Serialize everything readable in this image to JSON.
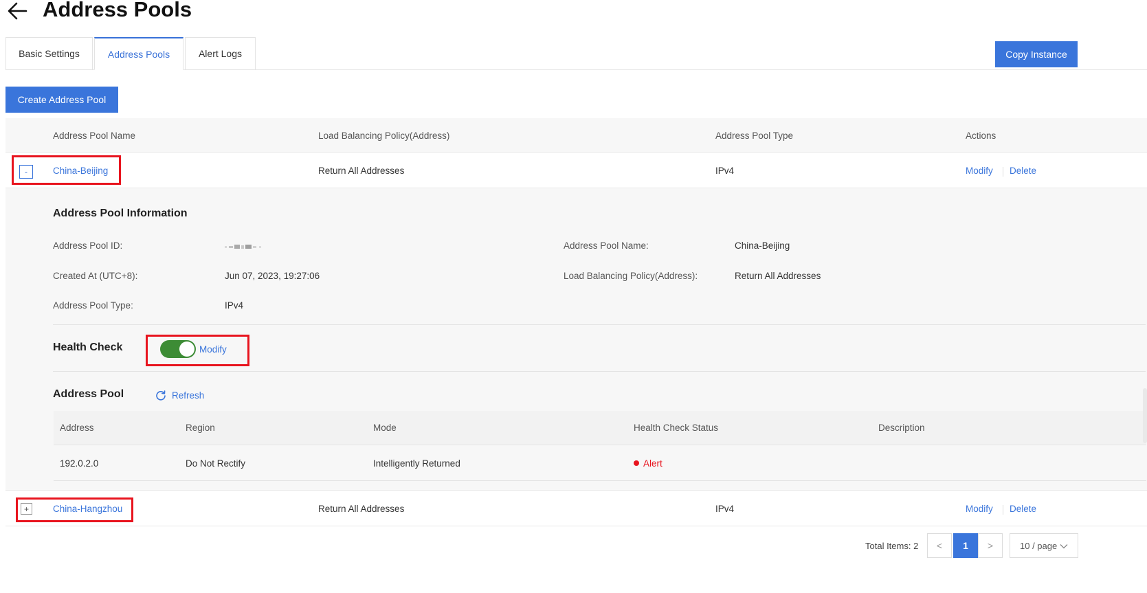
{
  "header": {
    "title": "Address Pools"
  },
  "tabs": [
    {
      "label": "Basic Settings"
    },
    {
      "label": "Address Pools"
    },
    {
      "label": "Alert Logs"
    }
  ],
  "buttons": {
    "copy_instance": "Copy Instance",
    "create_pool": "Create Address Pool"
  },
  "table": {
    "columns": [
      "Address Pool Name",
      "Load Balancing Policy(Address)",
      "Address Pool Type",
      "Actions"
    ],
    "rows": [
      {
        "expand": "-",
        "name": "China-Beijing",
        "policy": "Return All Addresses",
        "type": "IPv4",
        "modify": "Modify",
        "delete": "Delete"
      },
      {
        "expand": "+",
        "name": "China-Hangzhou",
        "policy": "Return All Addresses",
        "type": "IPv4",
        "modify": "Modify",
        "delete": "Delete"
      }
    ]
  },
  "details": {
    "info_title": "Address Pool Information",
    "labels": {
      "id": "Address Pool ID:",
      "created": "Created At (UTC+8):",
      "type": "Address Pool Type:",
      "name": "Address Pool Name:",
      "policy": "Load Balancing Policy(Address):"
    },
    "values": {
      "created": "Jun 07, 2023, 19:27:06",
      "type": "IPv4",
      "name": "China-Beijing",
      "policy": "Return All Addresses"
    },
    "health_check": {
      "title": "Health Check",
      "enabled": true,
      "modify": "Modify"
    },
    "address_pool": {
      "title": "Address Pool",
      "refresh": "Refresh",
      "columns": [
        "Address",
        "Region",
        "Mode",
        "Health Check Status",
        "Description"
      ],
      "rows": [
        {
          "address": "192.0.2.0",
          "region": "Do Not Rectify",
          "mode": "Intelligently Returned",
          "status": "Alert",
          "description": ""
        }
      ]
    }
  },
  "pagination": {
    "total": "Total Items: 2",
    "prev": "<",
    "page": "1",
    "next": ">",
    "per_page": "10 / page"
  },
  "colors": {
    "primary": "#3a75db",
    "toggle_on": "#3d8c35",
    "alert": "#e8141e",
    "highlight_frame": "#e8141e"
  }
}
